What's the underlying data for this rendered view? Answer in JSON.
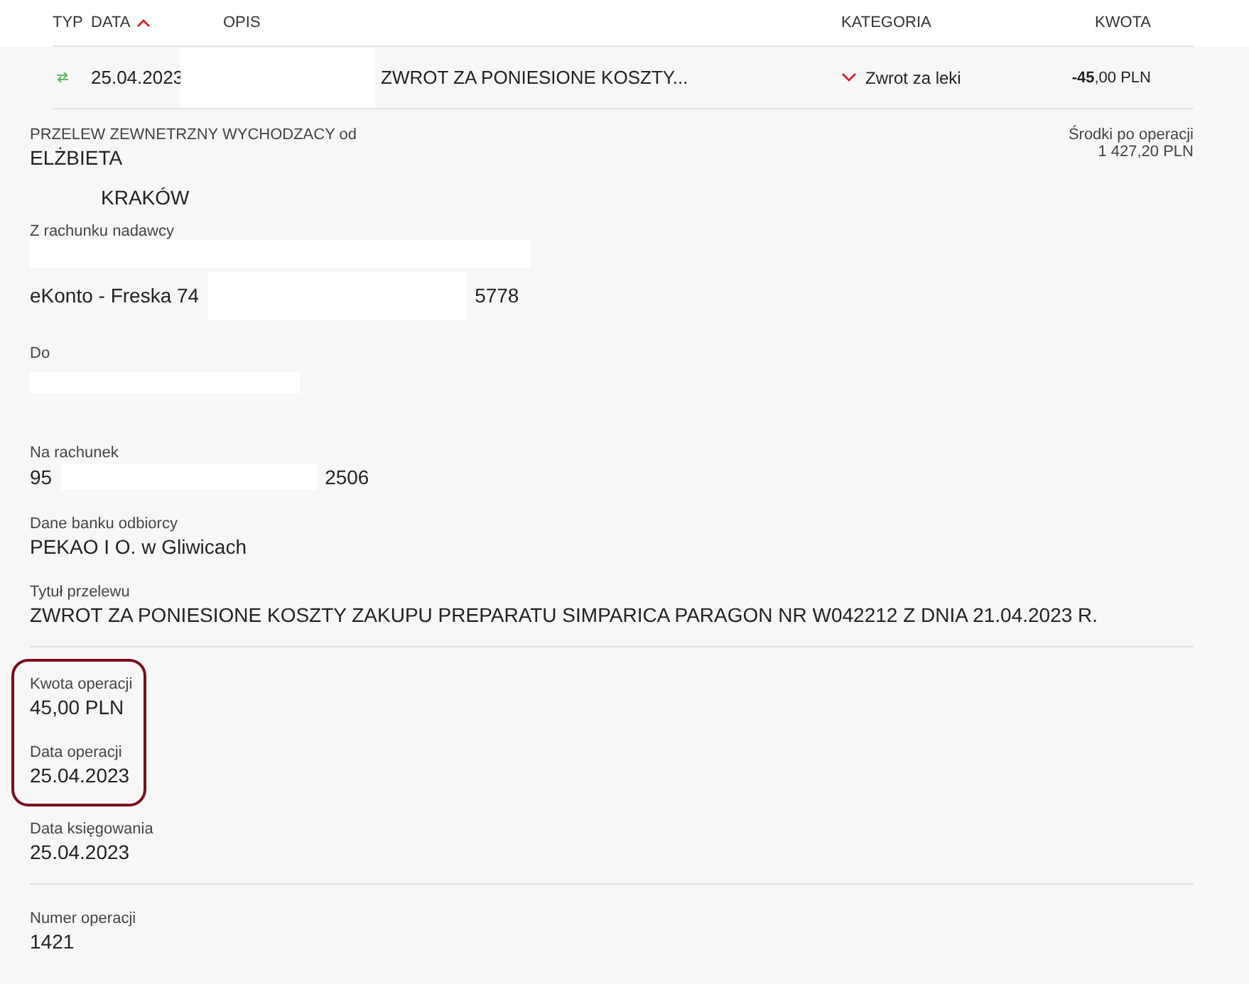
{
  "table": {
    "columns": [
      {
        "label": "TYP",
        "sorted": false
      },
      {
        "label": "DATA",
        "sorted": true
      },
      {
        "label": "OPIS",
        "sorted": false
      },
      {
        "label": "KATEGORIA",
        "sorted": false
      },
      {
        "label": "KWOTA",
        "sorted": false
      }
    ],
    "row": {
      "date": "25.04.2023",
      "description": "ZWROT ZA PONIESIONE KOSZTY...",
      "category": "Zwrot za leki",
      "amount": "**-45**,00 PLN"
    }
  },
  "details": {
    "type_label": "PRZELEW ZEWNETRZNY WYCHODZACY od",
    "name": "ELŻBIETA",
    "city": "KRAKÓW",
    "balance_label": "Środki po operacji",
    "balance": "1 427,20 PLN",
    "sections": [
      [
        {
          "label": "Z rachunku nadawcy",
          "kind": "split_double",
          "values": [
            "eKonto - Freska 74",
            "5778"
          ]
        },
        {
          "label": "Do",
          "kind": "blank"
        },
        {
          "label": "Na rachunek",
          "kind": "split",
          "values": [
            "95",
            "2506"
          ]
        },
        {
          "label": "Dane banku odbiorcy",
          "kind": "plain",
          "values": [
            "PEKAO I O. w Gliwicach"
          ]
        },
        {
          "label": "Tytuł przelewu",
          "kind": "plain",
          "values": [
            "ZWROT ZA PONIESIONE KOSZTY ZAKUPU PREPARATU SIMPARICA PARAGON NR W042212 Z DNIA 21.04.2023 R."
          ]
        }
      ],
      [
        {
          "label": "Kwota operacji",
          "kind": "plain",
          "highlighted": true,
          "values": [
            "45,00 PLN"
          ]
        },
        {
          "label": "Data operacji",
          "kind": "plain",
          "highlighted": true,
          "values": [
            "25.04.2023"
          ]
        },
        {
          "label": "Data księgowania",
          "kind": "plain",
          "highlighted": false,
          "values": [
            "25.04.2023"
          ]
        }
      ],
      [
        {
          "label": "Numer operacji",
          "kind": "plain",
          "highlighted": false,
          "values": [
            "1421"
          ]
        }
      ]
    ]
  }
}
